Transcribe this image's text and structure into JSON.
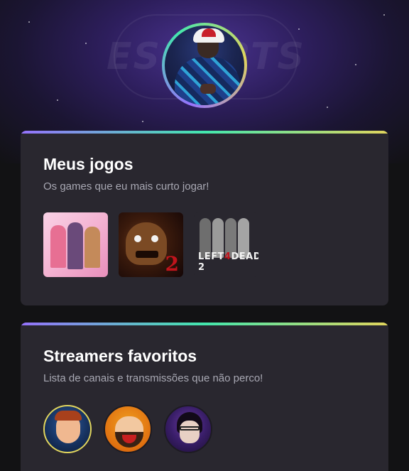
{
  "profile": {
    "avatar_alt": "profile-photo"
  },
  "cards": {
    "games": {
      "title": "Meus jogos",
      "subtitle": "Os games que eu mais curto jogar!",
      "items": [
        {
          "name": "Doki Doki Literature Club"
        },
        {
          "name": "Five Nights at Freddy's 2",
          "badge": "2"
        },
        {
          "name": "Left 4 Dead 2",
          "logo_left": "LEFT",
          "logo_num": "4",
          "logo_right": "DEAD 2"
        }
      ]
    },
    "streamers": {
      "title": "Streamers favoritos",
      "subtitle": "Lista de canais e transmissões que não perco!",
      "items": [
        {
          "name": "streamer-1"
        },
        {
          "name": "streamer-2"
        },
        {
          "name": "streamer-3"
        }
      ]
    }
  },
  "colors": {
    "background": "#121214",
    "card": "#29272f",
    "gradient": [
      "#9572fc",
      "#43e7ad",
      "#e1d55d"
    ],
    "text_primary": "#ffffff",
    "text_secondary": "#a8a8b3"
  }
}
